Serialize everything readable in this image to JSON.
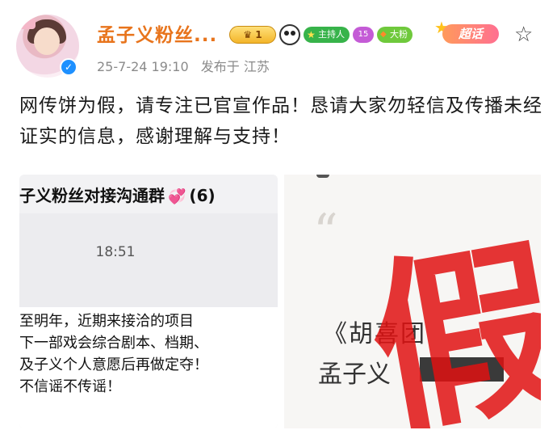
{
  "post": {
    "username": "孟子义粉丝...",
    "badges": {
      "level": "1",
      "host": "主持人",
      "diamond": "15",
      "fan": "大粉"
    },
    "chaohua_label": "超话",
    "date": "25-7-24 19:10",
    "source": "发布于 江苏",
    "text": "网传饼为假，请专注已官宣作品！恳请大家勿轻信及传播未经证实的信息，感谢理解与支持！"
  },
  "left_image": {
    "group_title": "子义粉丝对接沟通群",
    "group_count": "(6)",
    "chat_time": "18:51",
    "message_lines": [
      "至明年，近期来接洽的项目",
      "下一部戏会综合剧本、档期、",
      "及子义个人意愿后再做定夺！",
      "不信谣不传谣！"
    ]
  },
  "right_image": {
    "quote": "“",
    "title": "《胡喜团",
    "name": "孟子义",
    "stamp": "假"
  },
  "colors": {
    "username": "#e8741c",
    "meta": "#8a8a8a",
    "stamp": "#e11212"
  }
}
